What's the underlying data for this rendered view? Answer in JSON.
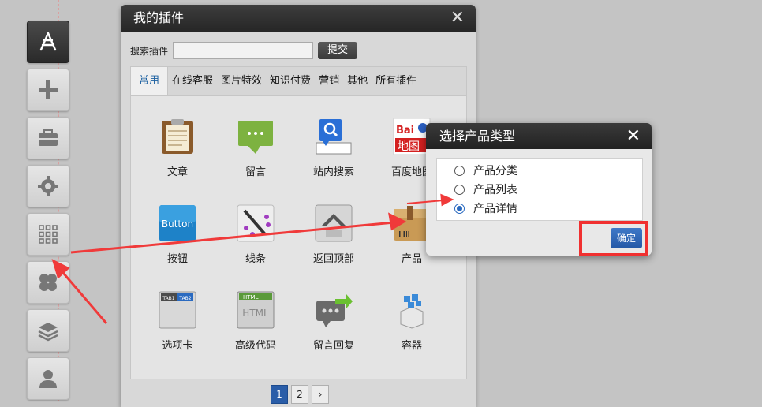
{
  "plugin_dialog": {
    "title": "我的插件",
    "close": "✕",
    "search_label": "搜索插件",
    "search_value": "",
    "submit_label": "提交",
    "tabs": [
      "常用",
      "在线客服",
      "图片特效",
      "知识付费",
      "营销",
      "其他",
      "所有插件"
    ],
    "active_tab": "常用",
    "items": [
      {
        "label": "文章",
        "icon": "clipboard-icon"
      },
      {
        "label": "留言",
        "icon": "message-bubble-icon"
      },
      {
        "label": "站内搜索",
        "icon": "search-icon"
      },
      {
        "label": "百度地图",
        "icon": "baidu-map-icon"
      },
      {
        "label": "按钮",
        "icon": "button-icon"
      },
      {
        "label": "线条",
        "icon": "line-pen-icon"
      },
      {
        "label": "返回顶部",
        "icon": "back-to-top-icon"
      },
      {
        "label": "产品",
        "icon": "product-box-icon"
      },
      {
        "label": "选项卡",
        "icon": "tab-card-icon"
      },
      {
        "label": "高级代码",
        "icon": "html-code-icon"
      },
      {
        "label": "留言回复",
        "icon": "message-reply-icon"
      },
      {
        "label": "容器",
        "icon": "container-icon"
      }
    ],
    "pager": [
      "1",
      "2",
      "›"
    ],
    "current_page": "1"
  },
  "icon_text": {
    "button": "Button",
    "baidu_1": "Bai",
    "baidu_2": "地图",
    "html": "HTML",
    "tab1": "TAB1",
    "tab2": "TAB2"
  },
  "product_modal": {
    "title": "选择产品类型",
    "close": "✕",
    "options": [
      {
        "label": "产品分类",
        "selected": false
      },
      {
        "label": "产品列表",
        "selected": false
      },
      {
        "label": "产品详情",
        "selected": true
      }
    ],
    "confirm_label": "确定"
  },
  "sidebar": {
    "buttons": [
      "app-store-icon",
      "plus-icon",
      "toolbox-icon",
      "gear-icon",
      "grid-icon",
      "clover-icon",
      "layers-icon",
      "user-icon"
    ],
    "active": "app-store-icon"
  },
  "colors": {
    "accent": "#2a5da8",
    "highlight": "#f03030",
    "titlebar": "#2a2a2a"
  }
}
